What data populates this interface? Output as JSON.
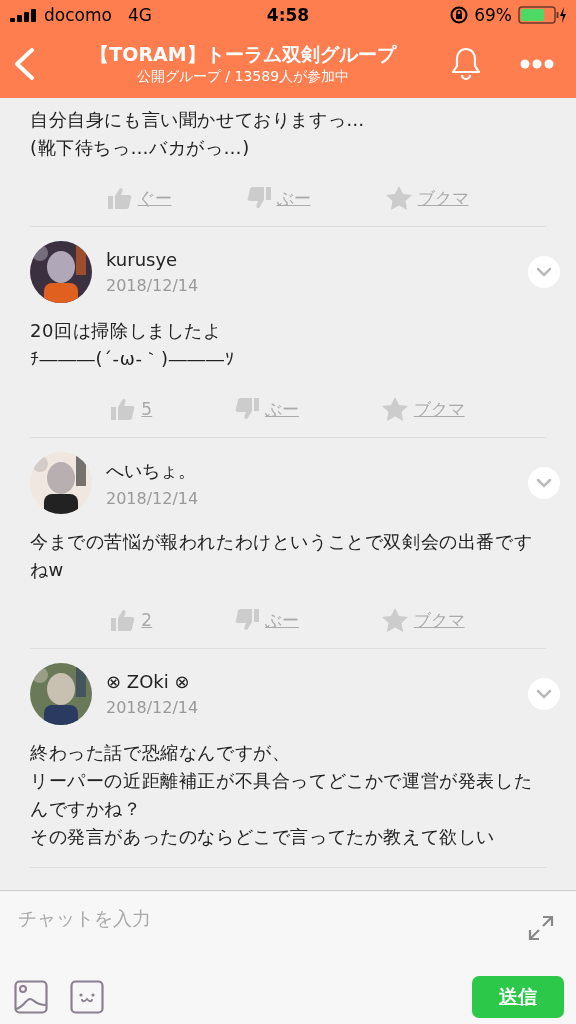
{
  "status_bar": {
    "carrier": "docomo",
    "network": "4G",
    "time": "4:58",
    "battery": "69%"
  },
  "header": {
    "title": "【TORAM】トーラム双剣グループ",
    "subtitle": "公開グループ / 13589人が参加中"
  },
  "posts": [
    {
      "lines": [
        "自分自身にも言い聞かせておりますっ…",
        "(靴下待ちっ…バカがっ…)"
      ],
      "reactions": [
        {
          "kind": "like",
          "label": "ぐー"
        },
        {
          "kind": "dislike",
          "label": "ぶー"
        },
        {
          "kind": "bookmark",
          "label": "ブクマ"
        }
      ]
    },
    {
      "author": "kurusye",
      "date": "2018/12/14",
      "lines": [
        "20回は掃除しましたよ",
        "ﾁ―――(´-ω-｀)―――ｿ"
      ],
      "reactions": [
        {
          "kind": "like",
          "label": "5"
        },
        {
          "kind": "dislike",
          "label": "ぶー"
        },
        {
          "kind": "bookmark",
          "label": "ブクマ"
        }
      ]
    },
    {
      "author": "へいちょ。",
      "date": "2018/12/14",
      "lines": [
        "今までの苦悩が報われたわけということで双剣会の出番ですねw"
      ],
      "reactions": [
        {
          "kind": "like",
          "label": "2"
        },
        {
          "kind": "dislike",
          "label": "ぶー"
        },
        {
          "kind": "bookmark",
          "label": "ブクマ"
        }
      ]
    },
    {
      "author": "⊗ ZOki ⊗",
      "date": "2018/12/14",
      "lines": [
        "終わった話で恐縮なんですが、",
        "リーパーの近距離補正が不具合ってどこかで運営が発表したんですかね？",
        "その発言があったのならどこで言ってたか教えて欲しい"
      ]
    }
  ],
  "composer": {
    "placeholder": "チャットを入力",
    "send": "送信"
  }
}
